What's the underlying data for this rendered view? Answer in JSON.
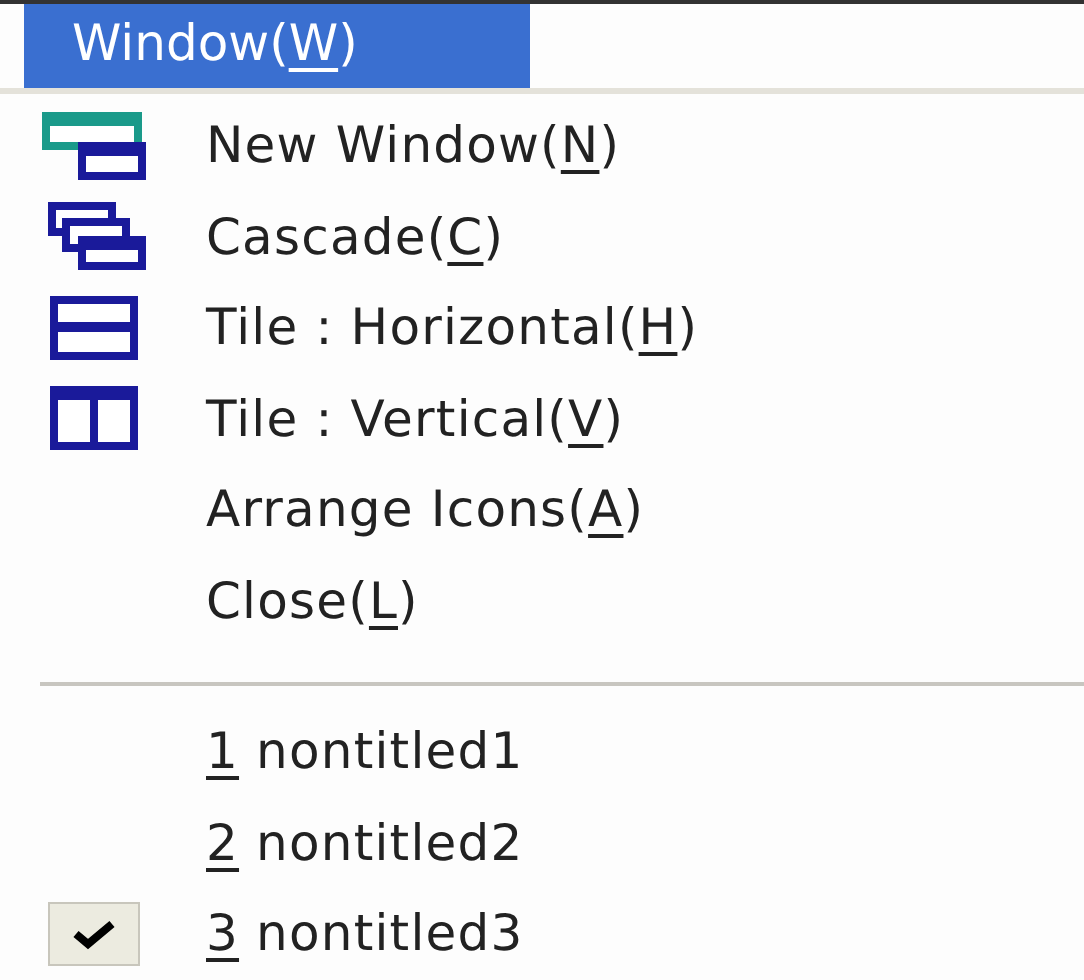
{
  "menu_title": {
    "text": "Window(",
    "mnemonic": "W",
    "suffix": ")",
    "selected": true
  },
  "commands": [
    {
      "kind": "new-window",
      "text": "New Window(",
      "mnemonic": "N",
      "suffix": ")"
    },
    {
      "kind": "cascade",
      "text": "Cascade(",
      "mnemonic": "C",
      "suffix": ")"
    },
    {
      "kind": "tile-horizontal",
      "text": "Tile : Horizontal(",
      "mnemonic": "H",
      "suffix": ")"
    },
    {
      "kind": "tile-vertical",
      "text": "Tile : Vertical(",
      "mnemonic": "V",
      "suffix": ")"
    },
    {
      "text": "Arrange Icons(",
      "mnemonic": "A",
      "suffix": ")"
    },
    {
      "text": "Close(",
      "mnemonic": "L",
      "suffix": ")"
    }
  ],
  "windows": [
    {
      "mnemonic": "1",
      "text": " nontitled1",
      "checked": false
    },
    {
      "mnemonic": "2",
      "text": " nontitled2",
      "checked": false
    },
    {
      "mnemonic": "3",
      "text": " nontitled3",
      "checked": true
    }
  ]
}
